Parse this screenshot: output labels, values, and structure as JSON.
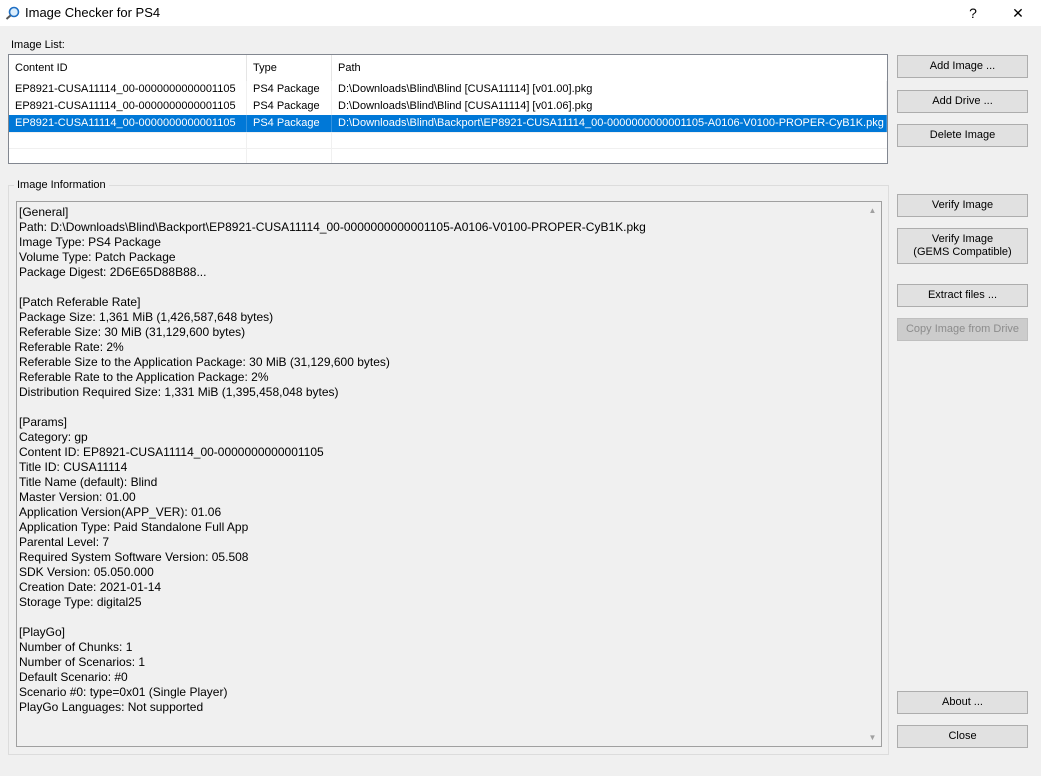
{
  "window": {
    "title": "Image Checker for PS4",
    "help_label": "?",
    "close_label": "✕"
  },
  "image_list": {
    "label": "Image List:",
    "columns": [
      "Content ID",
      "Type",
      "Path"
    ],
    "rows": [
      {
        "content_id": "EP8921-CUSA11114_00-0000000000001105",
        "type": "PS4 Package",
        "path": "D:\\Downloads\\Blind\\Blind [CUSA11114] [v01.00].pkg",
        "selected": false
      },
      {
        "content_id": "EP8921-CUSA11114_00-0000000000001105",
        "type": "PS4 Package",
        "path": "D:\\Downloads\\Blind\\Blind [CUSA11114] [v01.06].pkg",
        "selected": false
      },
      {
        "content_id": "EP8921-CUSA11114_00-0000000000001105",
        "type": "PS4 Package",
        "path": "D:\\Downloads\\Blind\\Backport\\EP8921-CUSA11114_00-0000000000001105-A0106-V0100-PROPER-CyB1K.pkg",
        "selected": true
      }
    ]
  },
  "image_info": {
    "label": "Image Information",
    "text": "[General]\nPath: D:\\Downloads\\Blind\\Backport\\EP8921-CUSA11114_00-0000000000001105-A0106-V0100-PROPER-CyB1K.pkg\nImage Type: PS4 Package\nVolume Type: Patch Package\nPackage Digest: 2D6E65D88B88...\n\n[Patch Referable Rate]\nPackage Size: 1,361 MiB (1,426,587,648 bytes)\nReferable Size: 30 MiB (31,129,600 bytes)\nReferable Rate: 2%\nReferable Size to the Application Package: 30 MiB (31,129,600 bytes)\nReferable Rate to the Application Package: 2%\nDistribution Required Size: 1,331 MiB (1,395,458,048 bytes)\n\n[Params]\nCategory: gp\nContent ID: EP8921-CUSA11114_00-0000000000001105\nTitle ID: CUSA11114\nTitle Name (default): Blind\nMaster Version: 01.00\nApplication Version(APP_VER): 01.06\nApplication Type: Paid Standalone Full App\nParental Level: 7\nRequired System Software Version: 05.508\nSDK Version: 05.050.000\nCreation Date: 2021-01-14\nStorage Type: digital25\n\n[PlayGo]\nNumber of Chunks: 1\nNumber of Scenarios: 1\nDefault Scenario: #0\nScenario #0: type=0x01 (Single Player)\nPlayGo Languages: Not supported"
  },
  "buttons": {
    "add_image": "Add Image ...",
    "add_drive": "Add Drive ...",
    "delete_image": "Delete Image",
    "verify_image": "Verify Image",
    "verify_gems_line1": "Verify Image",
    "verify_gems_line2": "(GEMS Compatible)",
    "extract_files": "Extract files ...",
    "copy_from_drive": "Copy Image from Drive",
    "about": "About ...",
    "close": "Close"
  },
  "colors": {
    "selection": "#0078d7",
    "window_bg": "#f0f0f0"
  }
}
